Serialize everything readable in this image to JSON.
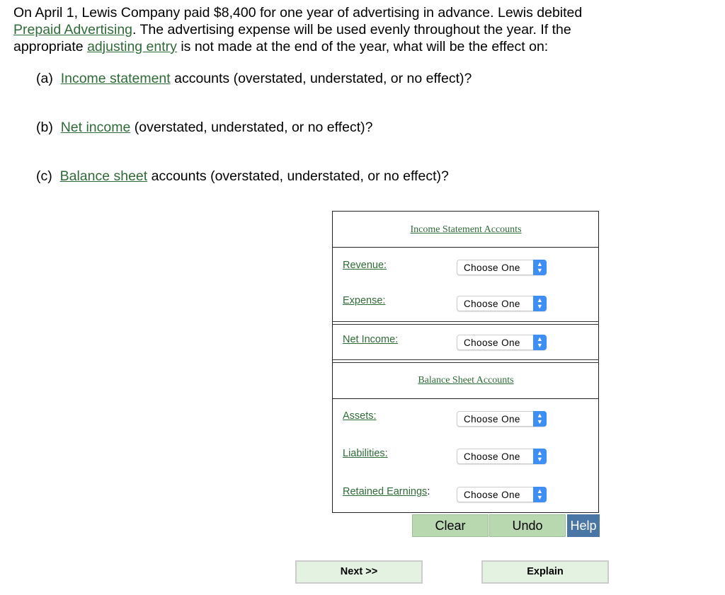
{
  "question": {
    "line1": "On April 1, Lewis Company paid $8,400 for one year of advertising in advance. Lewis debited",
    "link_prepaid": "Prepaid Advertising",
    "line2_rest": ". The advertising expense will be used evenly throughout the year. If the",
    "line3_pre": "appropriate ",
    "link_adjusting": "adjusting entry",
    "line3_rest": " is not made at the end of the year, what will be the effect on:"
  },
  "parts": [
    {
      "label": "(a)",
      "link": "Income statement",
      "rest": " accounts (overstated, understated, or no effect)?"
    },
    {
      "label": "(b)",
      "link": "Net income",
      "rest": " (overstated, understated, or no effect)?"
    },
    {
      "label": "(c)",
      "link": "Balance sheet",
      "rest": " accounts (overstated, understated, or no effect)?"
    }
  ],
  "table": {
    "income_header": "Income Statement Accounts",
    "balance_header": "Balance Sheet Accounts",
    "rows": [
      {
        "label": "Revenue:",
        "value": "Choose One"
      },
      {
        "label": "Expense:",
        "value": "Choose One"
      },
      {
        "label": "Net Income:",
        "value": "Choose One"
      },
      {
        "label": "Assets:",
        "value": "Choose One"
      },
      {
        "label": "Liabilities:",
        "value": "Choose One"
      },
      {
        "label": "Retained Earnings",
        "suffix": ":",
        "value": "Choose One"
      }
    ]
  },
  "buttons": {
    "clear": "Clear",
    "undo": "Undo",
    "help": "Help",
    "next": "Next >>",
    "explain": "Explain"
  },
  "colors": {
    "link": "#2e6b37",
    "green_button": "#b8d8b0",
    "help_button": "#4a76a5",
    "select_arrow": "#3d8ff5"
  }
}
